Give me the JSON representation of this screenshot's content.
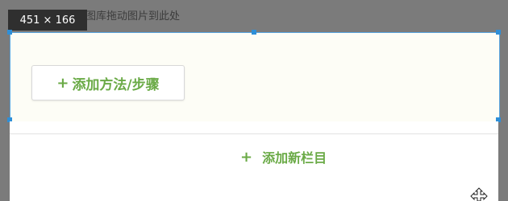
{
  "overlay": {
    "hint_text": "或从图库拖动图片到此处",
    "size_label": "451 × 166"
  },
  "editor": {
    "add_step_label": "添加方法/步骤",
    "add_column_label": "添加新栏目"
  },
  "icons": {
    "plus": "plus-icon",
    "cursor": "move-cursor-icon"
  },
  "colors": {
    "accent_green": "#6aaa46",
    "selection_blue": "#2e8fd8"
  }
}
